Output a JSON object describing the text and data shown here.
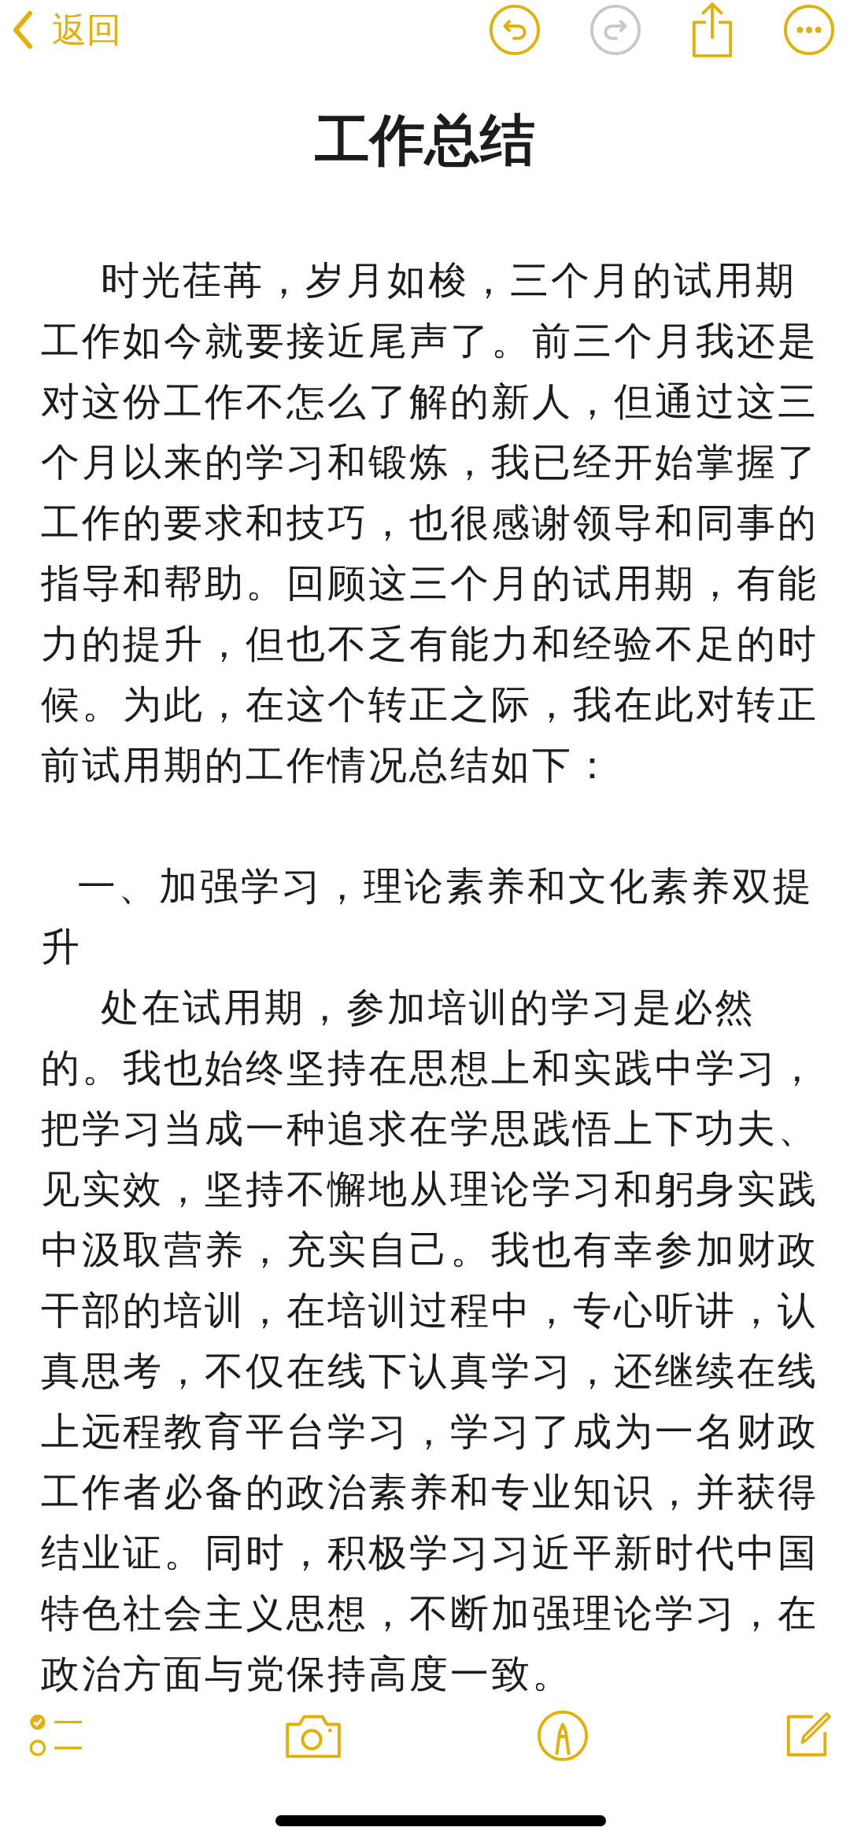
{
  "nav": {
    "back_label": "返回",
    "redo_disabled": true
  },
  "title": "工作总结",
  "paragraphs": [
    {
      "kind": "body",
      "text": "时光荏苒，岁月如梭，三个月的试用期工作如今就要接近尾声了。前三个月我还是对这份工作不怎么了解的新人，但通过这三个月以来的学习和锻炼，我已经开始掌握了工作的要求和技巧，也很感谢领导和同事的指导和帮助。回顾这三个月的试用期，有能力的提升，但也不乏有能力和经验不足的时候。为此，在这个转正之际，我在此对转正前试用期的工作情况总结如下："
    },
    {
      "kind": "heading",
      "text": "一、加强学习，理论素养和文化素养双提升"
    },
    {
      "kind": "body",
      "text": "处在试用期，参加培训的学习是必然的。我也始终坚持在思想上和实践中学习，把学习当成一种追求在学思践悟上下功夫、见实效，坚持不懈地从理论学习和躬身实践中汲取营养，充实自己。我也有幸参加财政干部的培训，在培训过程中，专心听讲，认真思考，不仅在线下认真学习，还继续在线上远程教育平台学习，学习了成为一名财政工作者必备的政治素养和专业知识，并获得结业证。同时，积极学习习近平新时代中国特色社会主义思想，不断加强理论学习，在政治方面与党保持高度一致。"
    }
  ]
}
